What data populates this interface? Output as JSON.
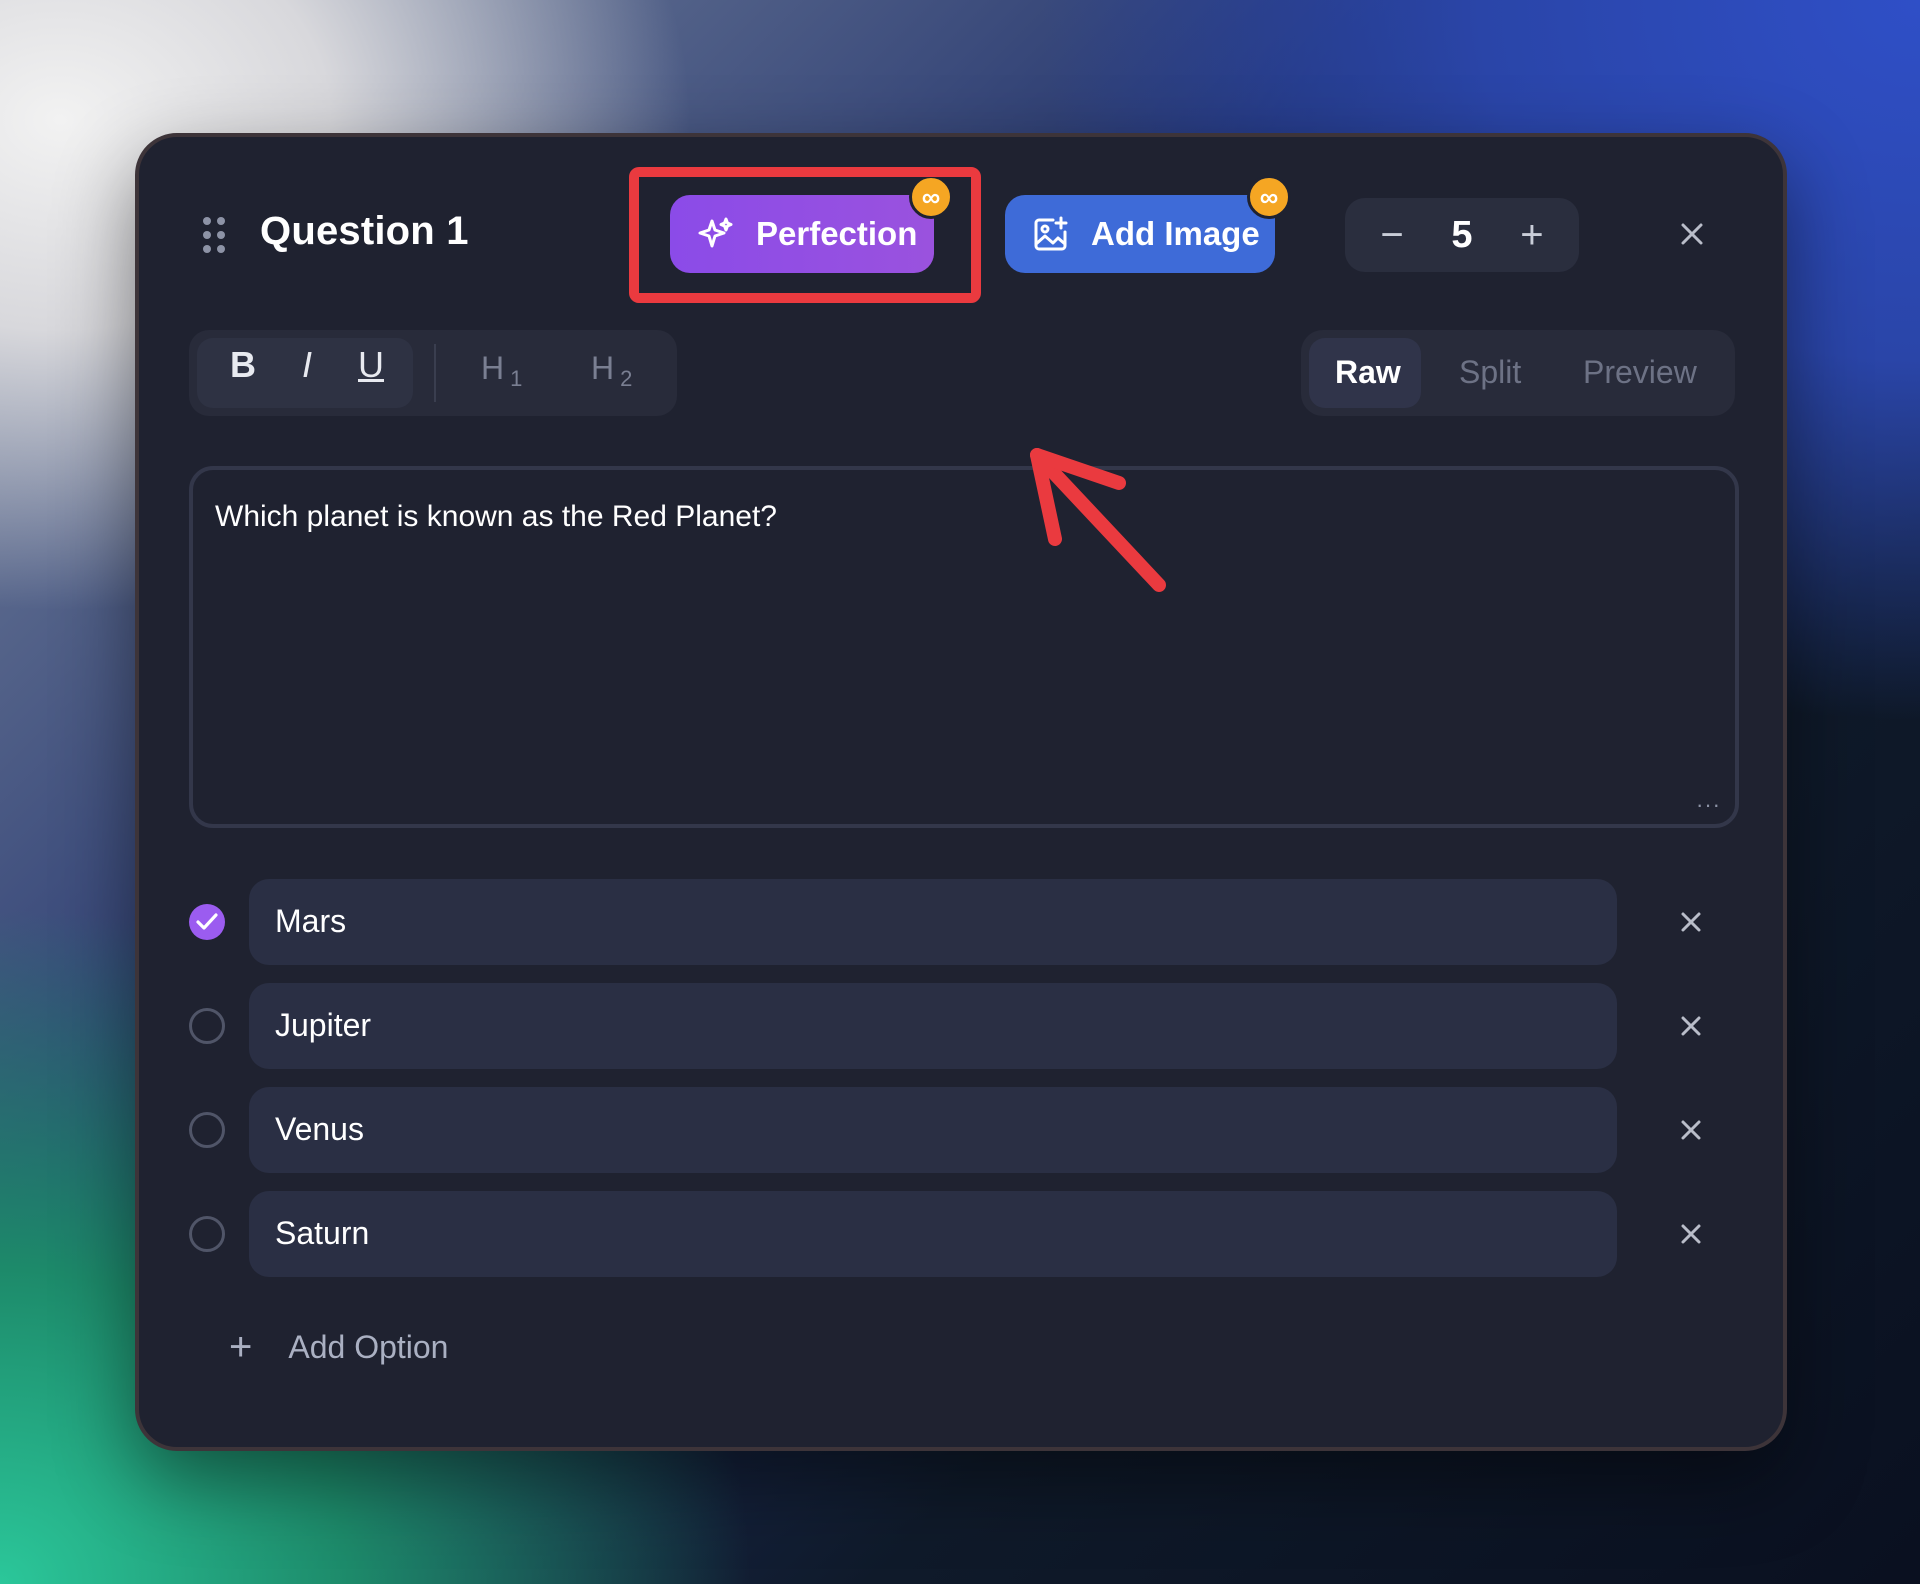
{
  "question": {
    "title": "Question 1",
    "body_text": "Which planet is known as the Red Planet?"
  },
  "header": {
    "perfection_label": "Perfection",
    "perfection_badge": "∞",
    "add_image_label": "Add Image",
    "add_image_badge": "∞",
    "points_value": "5",
    "decrement_symbol": "−",
    "increment_symbol": "+"
  },
  "format_toolbar": {
    "bold": "B",
    "italic": "I",
    "underline": "U",
    "h1": "H",
    "h1_sub": "1",
    "h2": "H",
    "h2_sub": "2"
  },
  "view_modes": {
    "raw": "Raw",
    "split": "Split",
    "preview": "Preview",
    "active": "Raw"
  },
  "options": [
    {
      "label": "Mars",
      "correct": true
    },
    {
      "label": "Jupiter",
      "correct": false
    },
    {
      "label": "Venus",
      "correct": false
    },
    {
      "label": "Saturn",
      "correct": false
    }
  ],
  "add_option_label": "Add Option",
  "colors": {
    "card_bg": "#1f2230",
    "perfection": "#8b4be8",
    "add_image": "#3e6bd8",
    "badge": "#f5a623",
    "highlight": "#ea3a3f",
    "checked": "#9b5cf0"
  },
  "icons": {
    "drag": "drag-handle-icon",
    "perfection": "sparkle-icon",
    "add_image": "image-plus-icon",
    "close": "close-icon",
    "check": "check-icon",
    "plus": "plus-icon"
  }
}
